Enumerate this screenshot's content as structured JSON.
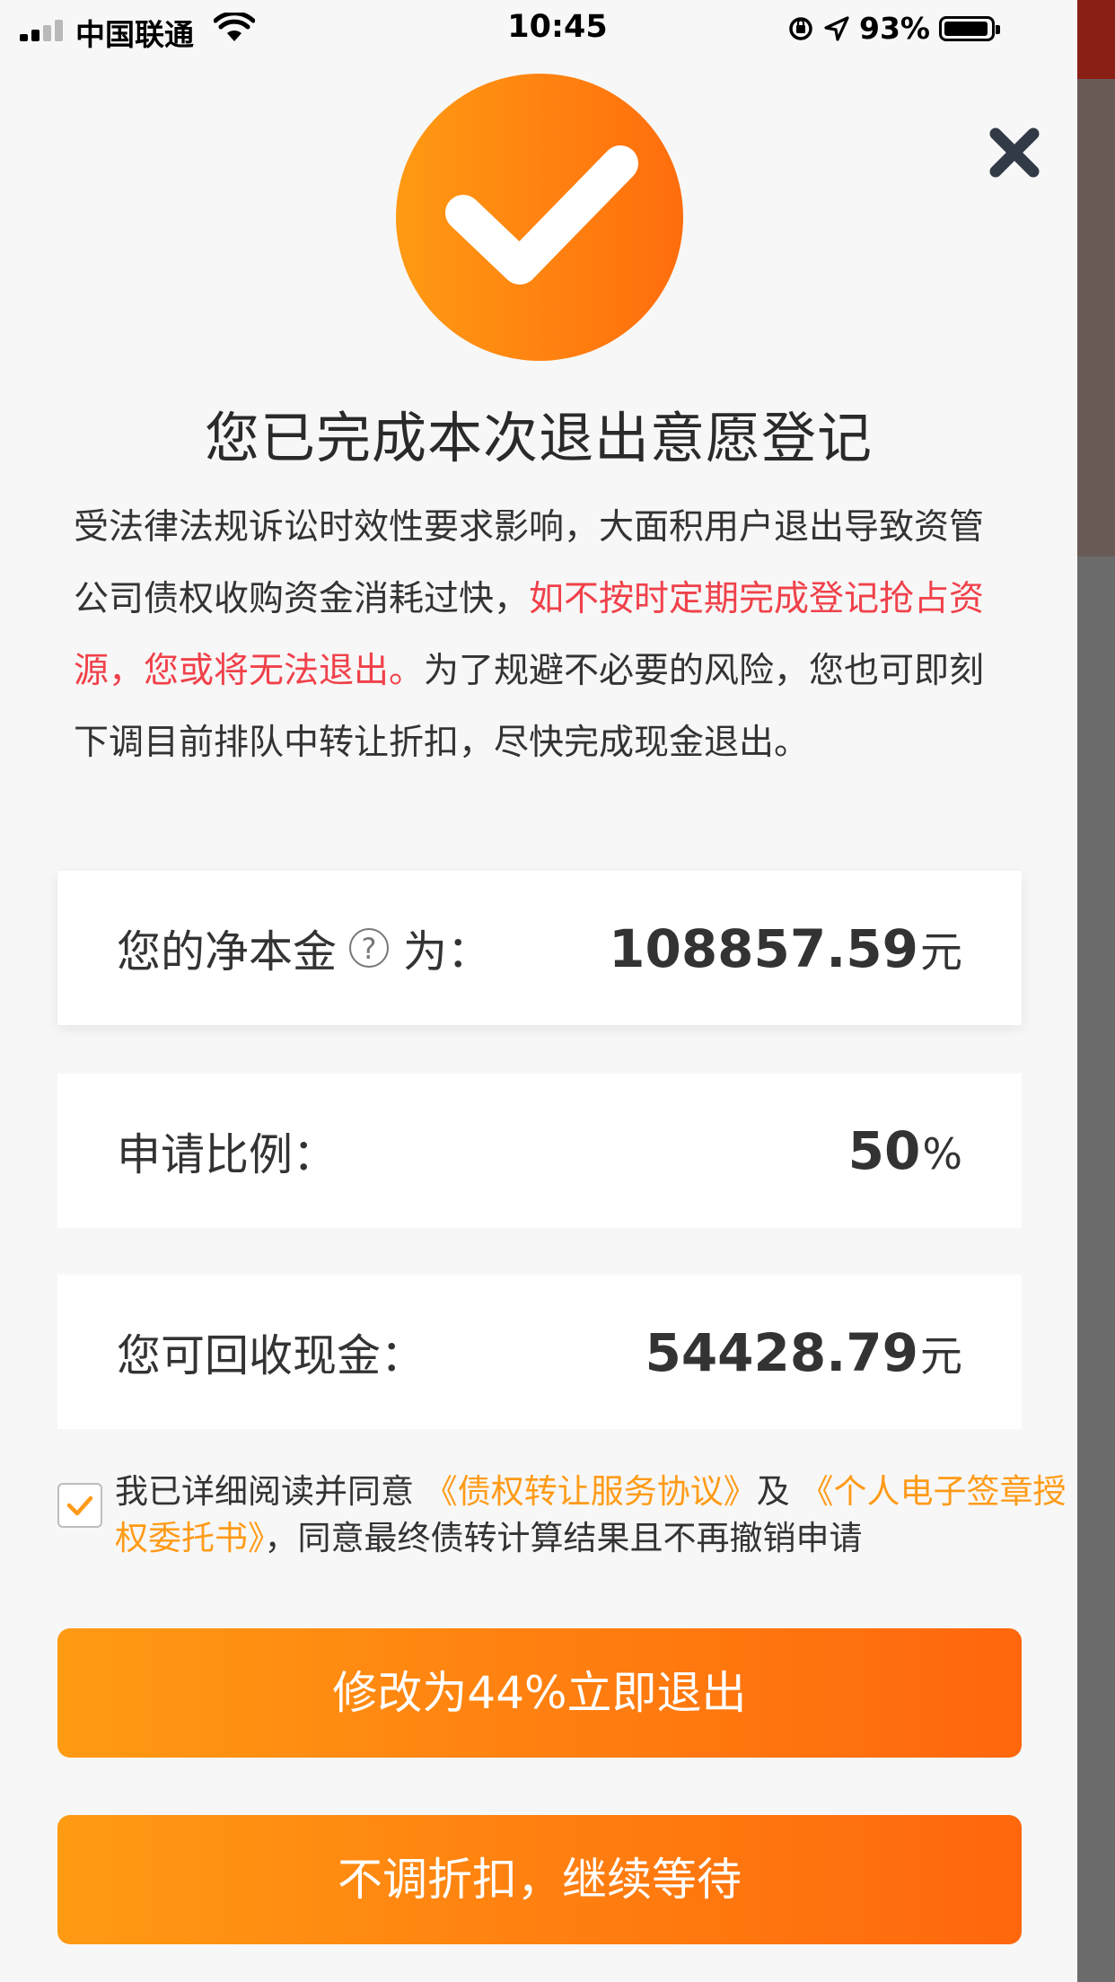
{
  "status_bar": {
    "carrier": "中国联通",
    "time": "10:45",
    "battery": "93%"
  },
  "icons": {
    "close": "close-icon",
    "success": "check-circle-icon",
    "help": "question-icon",
    "checkbox": "checkmark-icon"
  },
  "colors": {
    "accent": "#ff8a10",
    "warning_text": "#f0414a",
    "link_text": "#ff9b18"
  },
  "header": {
    "title": "您已完成本次退出意愿登记"
  },
  "description": {
    "part1": "受法律法规诉讼时效性要求影响，大面积用户退出导致资管公司债权收购资金消耗过快，",
    "warning": "如不按时定期完成登记抢占资源，您或将无法退出。",
    "part2": "为了规避不必要的风险，您也可即刻下调目前排队中转让折扣，尽快完成现金退出。"
  },
  "net_principal": {
    "label": "您的净本金",
    "help": "?",
    "label_suffix": "为：",
    "value": "108857.59",
    "unit": "元"
  },
  "apply_ratio": {
    "label": "申请比例：",
    "value": "50",
    "unit": "%"
  },
  "recoverable_cash": {
    "label": "您可回收现金：",
    "value": "54428.79",
    "unit": "元"
  },
  "agreement": {
    "checked": true,
    "prefix": "我已详细阅读并同意 ",
    "link1": "《债权转让服务协议》",
    "middle": "及 ",
    "link2": "《个人电子签章授权委托书》",
    "suffix": "，同意最终债转计算结果且不再撤销申请"
  },
  "buttons": {
    "modify_exit": "修改为44%立即退出",
    "keep_waiting": "不调折扣，继续等待"
  }
}
